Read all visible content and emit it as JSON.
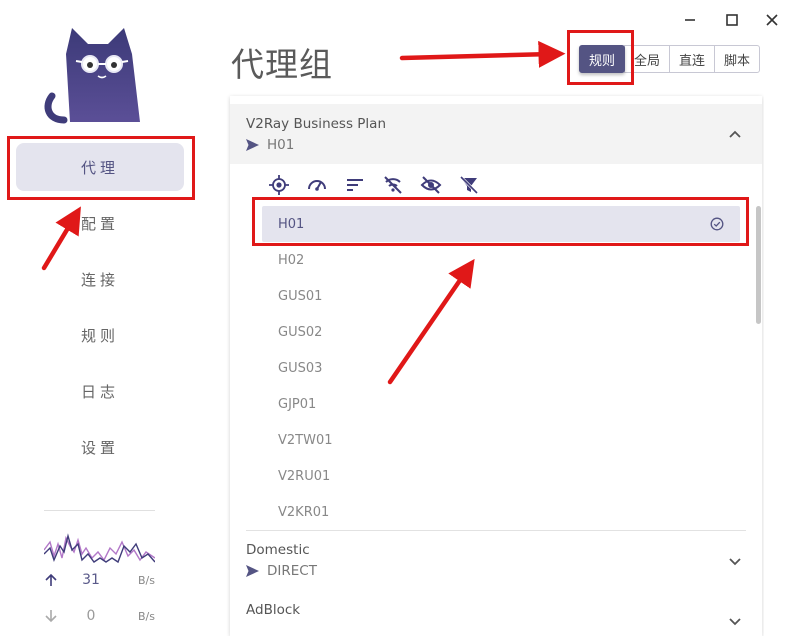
{
  "window": {
    "controls": [
      "minimize-icon",
      "maximize-icon",
      "close-icon"
    ]
  },
  "sidebar": {
    "items": [
      {
        "label": "代理",
        "active": true
      },
      {
        "label": "配置",
        "active": false
      },
      {
        "label": "连接",
        "active": false
      },
      {
        "label": "规则",
        "active": false
      },
      {
        "label": "日志",
        "active": false
      },
      {
        "label": "设置",
        "active": false
      }
    ],
    "traffic": {
      "upload": {
        "value": "31",
        "unit": "B/s"
      },
      "download": {
        "value": "0",
        "unit": "B/s"
      }
    }
  },
  "main": {
    "title": "代理组",
    "modes": [
      {
        "label": "规则",
        "active": true
      },
      {
        "label": "全局",
        "active": false
      },
      {
        "label": "直连",
        "active": false
      },
      {
        "label": "脚本",
        "active": false
      }
    ],
    "groups": [
      {
        "name": "V2Ray Business Plan",
        "selected": "H01",
        "expanded": true,
        "toolbar_icons": [
          "target-icon",
          "speed-gauge-icon",
          "sort-icon",
          "signal-off-icon",
          "eye-off-icon",
          "filter-off-icon"
        ],
        "proxies": [
          "H01",
          "H02",
          "GUS01",
          "GUS02",
          "GUS03",
          "GJP01",
          "V2TW01",
          "V2RU01",
          "V2KR01"
        ],
        "selected_index": 0
      },
      {
        "name": "Domestic",
        "selected": "DIRECT",
        "expanded": false
      },
      {
        "name": "AdBlock",
        "selected": "",
        "expanded": false
      }
    ]
  },
  "colors": {
    "accent": "#545483",
    "annotation": "#e01818",
    "selected_bg": "#e4e4ee"
  }
}
